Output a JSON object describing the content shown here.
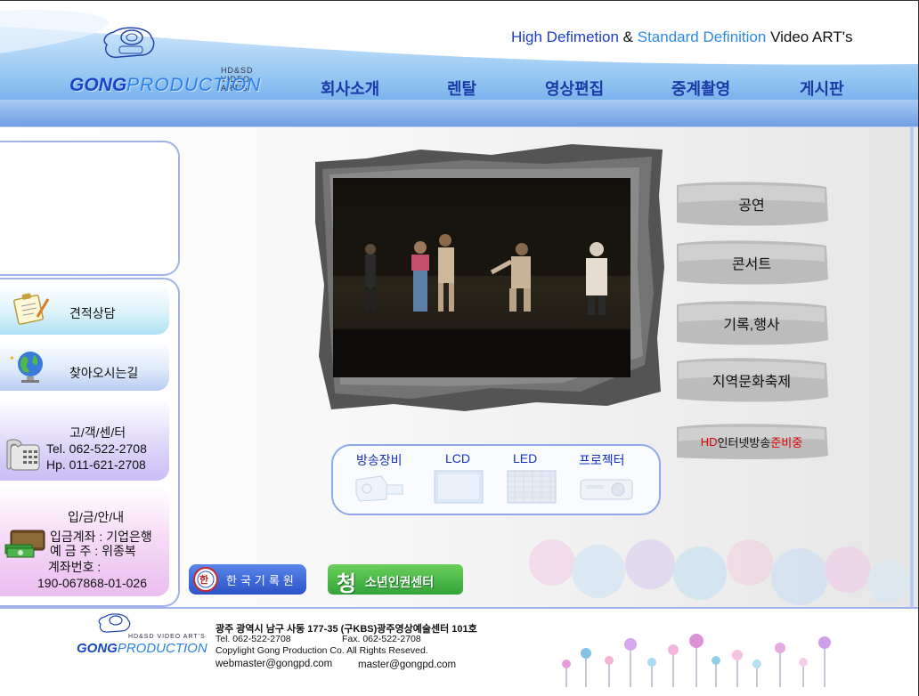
{
  "header": {
    "tagline_part1": "High Defimetion",
    "tagline_amp": " & ",
    "tagline_part2": "Standard Definition",
    "tagline_part3": " Video ART's",
    "logo_sub": "HD&SD VIDEO ART'S",
    "logo_main_a": "GONG",
    "logo_main_b": "PRODUCTION"
  },
  "nav": {
    "items": [
      {
        "label": "회사소개"
      },
      {
        "label": "렌탈"
      },
      {
        "label": "영상편집"
      },
      {
        "label": "중계촬영"
      },
      {
        "label": "게시판"
      }
    ]
  },
  "sidebar": {
    "estimate_label": "견적상담",
    "map_label": "찾아오시는길",
    "center": {
      "title": "고/객/센/터",
      "tel": "Tel. 062-522-2708",
      "hp": "Hp. 011-621-2708"
    },
    "deposit": {
      "title": "입/금/안/내",
      "bank": "입금계좌 : 기업은행",
      "holder": "예 금 주  : 위종복",
      "account_label": "계좌번호 :",
      "account_number": "190-067868-01-026"
    }
  },
  "categories": {
    "items": [
      {
        "label": "공연"
      },
      {
        "label": "콘서트"
      },
      {
        "label": "기록,행사"
      },
      {
        "label": "지역문화축제"
      }
    ],
    "hd_prefix": "HD",
    "hd_middle": "인터넷방송",
    "hd_suffix": "준비중"
  },
  "equipment": {
    "items": [
      {
        "label": "방송장비"
      },
      {
        "label": "LCD"
      },
      {
        "label": "LED"
      },
      {
        "label": "프로젝터"
      }
    ]
  },
  "banners": {
    "record_text": "한국기록원",
    "record_seal": "한",
    "youth_big": "청",
    "youth_text": "소년인권센터"
  },
  "footer": {
    "logo_sub": "HD&SD VIDEO ART'S",
    "logo_main_a": "GONG",
    "logo_main_b": "PRODUCTION",
    "address": "광주 광역시 남구 사동 177-35 (구KBS)광주영상예술센터 101호",
    "tel": "Tel. 062-522-2708",
    "fax": "Fax. 062-522-2708",
    "copyright": "Copylight Gong Production Co. All Rights Reseved.",
    "email1": "webmaster@gongpd.com",
    "email2": "master@gongpd.com"
  },
  "colors": {
    "nav_text": "#1a3aa8",
    "header_blue": "#6f9fe6",
    "hd_red": "#e00000",
    "equip_text": "#1530c0"
  }
}
